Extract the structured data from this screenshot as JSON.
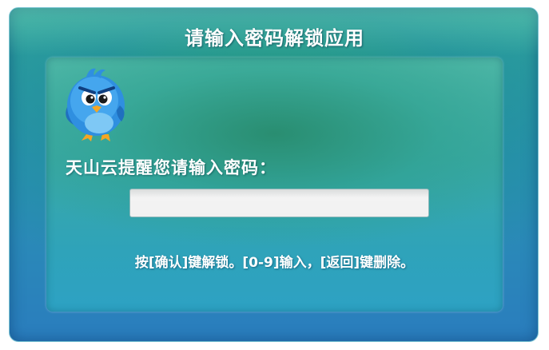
{
  "dialog": {
    "title": "请输入密码解锁应用",
    "prompt": "天山云提醒您请输入密码：",
    "password_value": "",
    "password_placeholder": "",
    "hint": "按[确认]键解锁。[0-9]输入，[返回]键删除。"
  },
  "icons": {
    "mascot": "blue-bird-mascot-icon"
  },
  "colors": {
    "frame_blue": "#2a7dbe",
    "panel_teal": "#3aa9a6",
    "text": "#ffffff",
    "input_bg": "#f1f1f1",
    "bird_blue": "#2f8fe0",
    "bird_beak": "#f5a623"
  }
}
